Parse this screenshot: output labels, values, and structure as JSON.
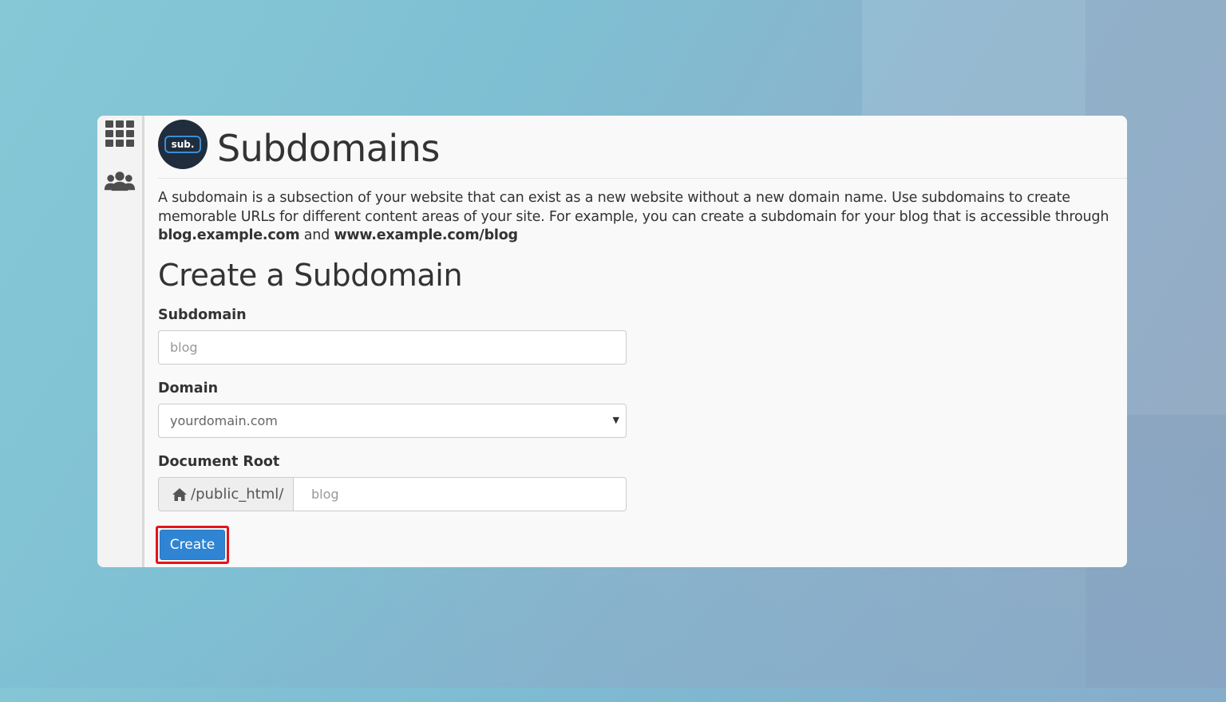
{
  "header": {
    "logo_text": "sub.",
    "title": "Subdomains"
  },
  "description": {
    "text": "A subdomain is a subsection of your website that can exist as a new website without a new domain name. Use subdomains to create memorable URLs for different content areas of your site. For example, you can create a subdomain for your blog that is accessible through ",
    "example1": "blog.example.com",
    "conjunction": " and ",
    "example2": "www.example.com/blog"
  },
  "form": {
    "title": "Create a Subdomain",
    "subdomain": {
      "label": "Subdomain",
      "placeholder": "blog"
    },
    "domain": {
      "label": "Domain",
      "selected": "yourdomain.com"
    },
    "document_root": {
      "label": "Document Root",
      "prefix": "/public_html/",
      "placeholder": "blog"
    },
    "submit_label": "Create"
  },
  "sidebar": {
    "items": [
      {
        "icon": "grid-icon"
      },
      {
        "icon": "users-icon"
      }
    ]
  }
}
